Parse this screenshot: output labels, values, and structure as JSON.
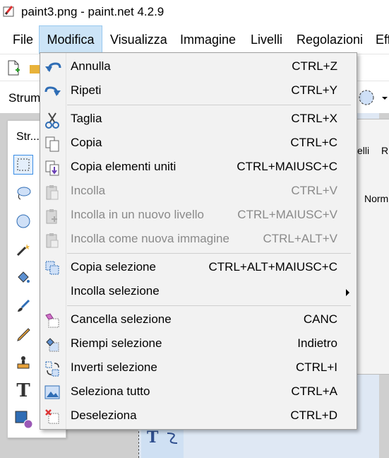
{
  "window": {
    "title": "paint3.png - paint.net 4.2.9",
    "app_icon": "paintnet-icon"
  },
  "menubar": {
    "items": [
      {
        "label": "File",
        "active": false
      },
      {
        "label": "Modifica",
        "active": true
      },
      {
        "label": "Visualizza",
        "active": false
      },
      {
        "label": "Immagine",
        "active": false
      },
      {
        "label": "Livelli",
        "active": false
      },
      {
        "label": "Regolazioni",
        "active": false
      },
      {
        "label": "Eff",
        "active": false
      }
    ]
  },
  "toolbar2": {
    "tools_label": "Strum"
  },
  "tools_window": {
    "title": "Str..."
  },
  "background_panel": {
    "label1": "elli",
    "label2": "Ri",
    "label3": "Norm"
  },
  "edit_menu": {
    "items": [
      {
        "label": "Annulla",
        "shortcut": "CTRL+Z",
        "icon": "undo-icon",
        "enabled": true
      },
      {
        "label": "Ripeti",
        "shortcut": "CTRL+Y",
        "icon": "redo-icon",
        "enabled": true
      },
      {
        "label": "Taglia",
        "shortcut": "CTRL+X",
        "icon": "scissors-icon",
        "enabled": true
      },
      {
        "label": "Copia",
        "shortcut": "CTRL+C",
        "icon": "copy-icon",
        "enabled": true
      },
      {
        "label": "Copia elementi uniti",
        "shortcut": "CTRL+MAIUSC+C",
        "icon": "copy-merged-icon",
        "enabled": true
      },
      {
        "label": "Incolla",
        "shortcut": "CTRL+V",
        "icon": "paste-icon",
        "enabled": false
      },
      {
        "label": "Incolla in un nuovo livello",
        "shortcut": "CTRL+MAIUSC+V",
        "icon": "paste-new-layer-icon",
        "enabled": false
      },
      {
        "label": "Incolla come nuova immagine",
        "shortcut": "CTRL+ALT+V",
        "icon": "paste-new-image-icon",
        "enabled": false
      },
      {
        "label": "Copia selezione",
        "shortcut": "CTRL+ALT+MAIUSC+C",
        "icon": "copy-selection-icon",
        "enabled": true
      },
      {
        "label": "Incolla selezione",
        "shortcut": "",
        "icon": "",
        "enabled": true,
        "submenu": true
      },
      {
        "label": "Cancella selezione",
        "shortcut": "CANC",
        "icon": "erase-selection-icon",
        "enabled": true
      },
      {
        "label": "Riempi selezione",
        "shortcut": "Indietro",
        "icon": "fill-selection-icon",
        "enabled": true
      },
      {
        "label": "Inverti selezione",
        "shortcut": "CTRL+I",
        "icon": "invert-selection-icon",
        "enabled": true
      },
      {
        "label": "Seleziona tutto",
        "shortcut": "CTRL+A",
        "icon": "select-all-icon",
        "enabled": true
      },
      {
        "label": "Deseleziona",
        "shortcut": "CTRL+D",
        "icon": "deselect-icon",
        "enabled": true
      }
    ]
  },
  "colors": {
    "accent": "#2f6db5",
    "menu_bg": "#f2f2f2",
    "menu_active": "#cce4f7",
    "disabled": "#8a8a8a"
  }
}
